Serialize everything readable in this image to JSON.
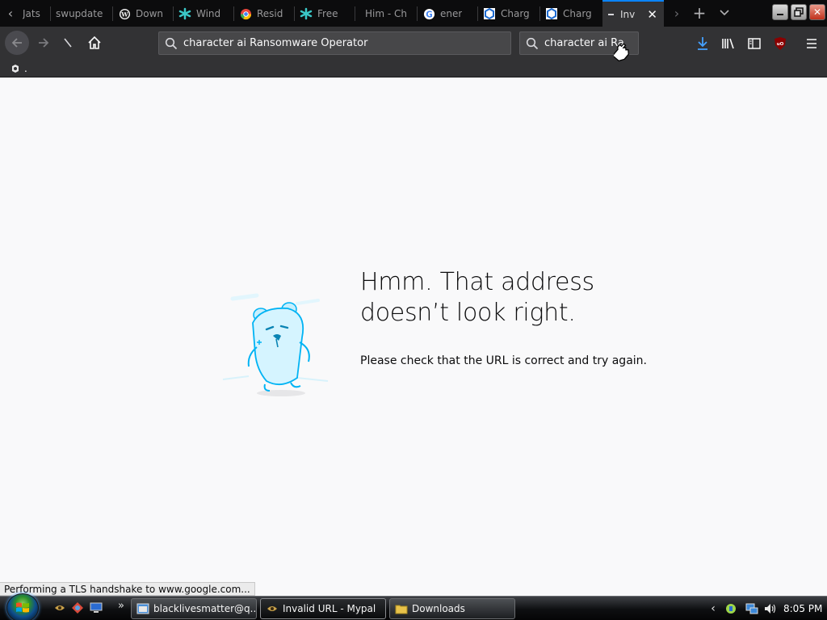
{
  "browser": {
    "tabs": [
      {
        "label": "Jats",
        "favicon": "generic-page-icon"
      },
      {
        "label": "swupdate",
        "favicon": "none"
      },
      {
        "label": "Down",
        "favicon": "wordpress-icon"
      },
      {
        "label": "Wind",
        "favicon": "dragonfly-icon"
      },
      {
        "label": "Resid",
        "favicon": "chrome-icon"
      },
      {
        "label": "Free ",
        "favicon": "dragonfly-icon"
      },
      {
        "label": "Him - Ch",
        "favicon": "none"
      },
      {
        "label": "ener",
        "favicon": "google-icon"
      },
      {
        "label": "Charg",
        "favicon": "character-ai-icon"
      },
      {
        "label": "Charg",
        "favicon": "character-ai-icon"
      },
      {
        "label": "Inv",
        "favicon": "loading-dash-icon",
        "selected": true
      }
    ],
    "urlbar": {
      "value": "character ai Ransomware Operator"
    },
    "searchbar": {
      "value": "character ai Ra"
    },
    "bookmarks": [
      {
        "label": "."
      }
    ]
  },
  "error_page": {
    "title_line1": "Hmm. That address",
    "title_line2": "doesn’t look right.",
    "description": "Please check that the URL is correct and try again."
  },
  "status_text": "Performing a TLS handshake to www.google.com...",
  "taskbar": {
    "quick_launch_chevron": "»",
    "tasks": [
      {
        "label": "blacklivesmatter@q...",
        "icon": "app-window-icon"
      },
      {
        "label": "Invalid URL - Mypal",
        "icon": "mypal-icon",
        "active": true
      },
      {
        "label": "Downloads",
        "icon": "folder-icon"
      }
    ],
    "clock": "8:05 PM"
  },
  "colors": {
    "tabstrip_bg": "#0c0c0d",
    "toolbar_bg": "#323234",
    "accent": "#0a84ff",
    "page_bg": "#f9f9fa",
    "illustration": "#00b3f4"
  }
}
